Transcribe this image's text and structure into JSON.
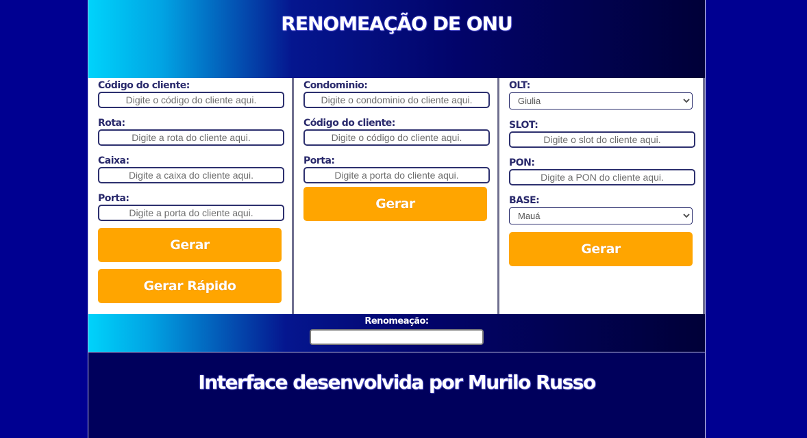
{
  "header": {
    "title": "RENOMEAÇÃO DE ONU"
  },
  "col_a": {
    "fields": [
      {
        "label": "Código do cliente:",
        "placeholder": "Digite o código do cliente aqui."
      },
      {
        "label": "Rota:",
        "placeholder": "Digite a rota do cliente aqui."
      },
      {
        "label": "Caixa:",
        "placeholder": "Digite a caixa do cliente aqui."
      },
      {
        "label": "Porta:",
        "placeholder": "Digite a porta do cliente aqui."
      }
    ],
    "generate_label": "Gerar",
    "quick_generate_label": "Gerar Rápido"
  },
  "col_b": {
    "fields": [
      {
        "label": "Condominio:",
        "placeholder": "Digite o condominio do cliente aqui."
      },
      {
        "label": "Código do cliente:",
        "placeholder": "Digite o código do cliente aqui."
      },
      {
        "label": "Porta:",
        "placeholder": "Digite a porta do cliente aqui."
      }
    ],
    "generate_label": "Gerar"
  },
  "col_c": {
    "olt_label": "OLT:",
    "olt_value": "Giulia",
    "slot_label": "SLOT:",
    "slot_placeholder": "Digite o slot do cliente aqui.",
    "pon_label": "PON:",
    "pon_placeholder": "Digite a PON do cliente aqui.",
    "base_label": "BASE:",
    "base_value": "Mauá",
    "generate_label": "Gerar"
  },
  "result": {
    "label": "Renomeação:",
    "value": ""
  },
  "footer": {
    "credit": "Interface desenvolvida por Murilo Russo"
  },
  "colors": {
    "page_background": "#000091",
    "accent_button": "#ffa500",
    "label_text": "#2a2a6c",
    "footer_background": "#00005c"
  }
}
